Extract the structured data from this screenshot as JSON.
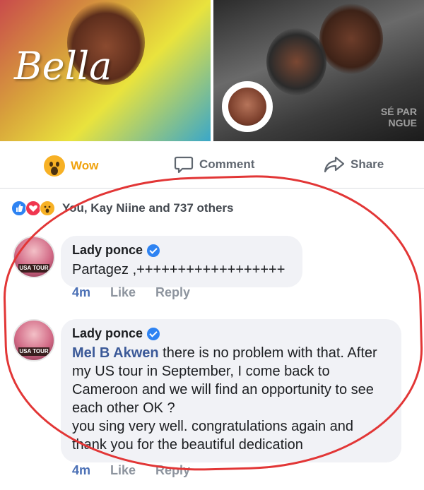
{
  "photos": {
    "left_title": "Bella",
    "right_watermark_line1": "SÉ PAR",
    "right_watermark_line2": "NGUE"
  },
  "actions": {
    "wow_label": "Wow",
    "comment_label": "Comment",
    "share_label": "Share"
  },
  "reactions": {
    "summary": "You, Kay Niine and 737 others",
    "icons": [
      "like-icon",
      "love-icon",
      "wow-icon"
    ]
  },
  "comments": [
    {
      "author": "Lady ponce",
      "text": "Partagez ,++++++++++++++++++",
      "time": "4m",
      "like_label": "Like",
      "reply_label": "Reply",
      "avatar_tag": "USA TOUR"
    },
    {
      "author": "Lady ponce",
      "mention": "Mel B Akwen",
      "text": " there is no problem with that. After my US tour in September, I come back to Cameroon and we will find an opportunity to see each other OK ?",
      "text2": "you sing very well. congratulations again and thank you for the beautiful dedication",
      "time": "4m",
      "like_label": "Like",
      "reply_label": "Reply",
      "avatar_tag": "USA TOUR"
    }
  ],
  "colors": {
    "wow_orange": "#f0a20d",
    "link_blue": "#3b5998",
    "annotation_red": "#e23636",
    "bubble_bg": "#f1f2f6"
  }
}
